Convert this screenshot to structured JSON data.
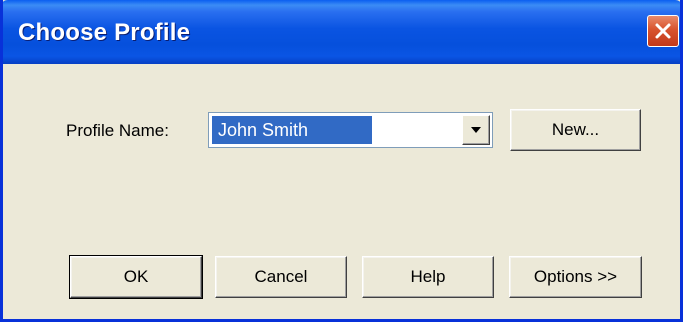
{
  "window": {
    "title": "Choose Profile",
    "close_icon": "close-icon"
  },
  "profile": {
    "label": "Profile Name:",
    "selected_value": "John Smith",
    "dropdown_icon": "chevron-down-icon",
    "new_label": "New..."
  },
  "buttons": {
    "ok": "OK",
    "cancel": "Cancel",
    "help": "Help",
    "options": "Options >>"
  },
  "colors": {
    "titlebar": "#0a54e2",
    "dialog_bg": "#ece9d8",
    "selection": "#316ac5",
    "close_button": "#d8532e"
  }
}
